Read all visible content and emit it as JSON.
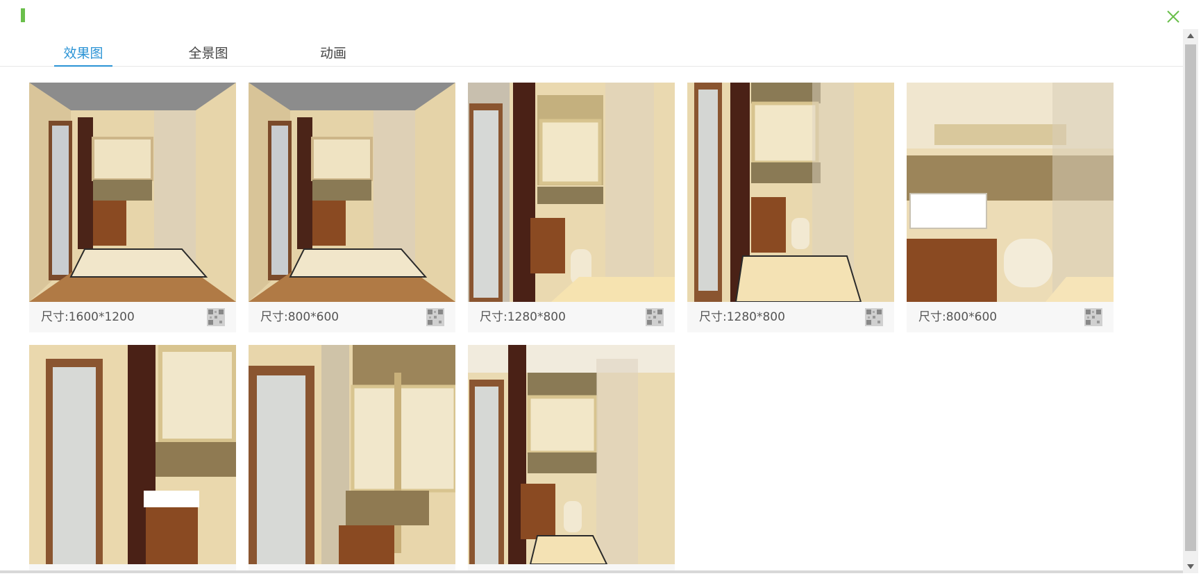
{
  "header": {
    "close_icon": "close-icon",
    "accent_color": "#6abf4b"
  },
  "tabs": [
    {
      "label": "效果图",
      "active": true
    },
    {
      "label": "全景图",
      "active": false
    },
    {
      "label": "动画",
      "active": false
    }
  ],
  "colors": {
    "tab_active": "#2a93d5"
  },
  "cards": [
    {
      "size_label": "尺寸:1600*1200",
      "qr_icon": "qr-code-icon"
    },
    {
      "size_label": "尺寸:800*600",
      "qr_icon": "qr-code-icon"
    },
    {
      "size_label": "尺寸:1280*800",
      "qr_icon": "qr-code-icon"
    },
    {
      "size_label": "尺寸:1280*800",
      "qr_icon": "qr-code-icon"
    },
    {
      "size_label": "尺寸:800*600",
      "qr_icon": "qr-code-icon"
    },
    {
      "size_label": "",
      "qr_icon": "qr-code-icon"
    },
    {
      "size_label": "",
      "qr_icon": "qr-code-icon"
    },
    {
      "size_label": "",
      "qr_icon": "qr-code-icon"
    }
  ]
}
